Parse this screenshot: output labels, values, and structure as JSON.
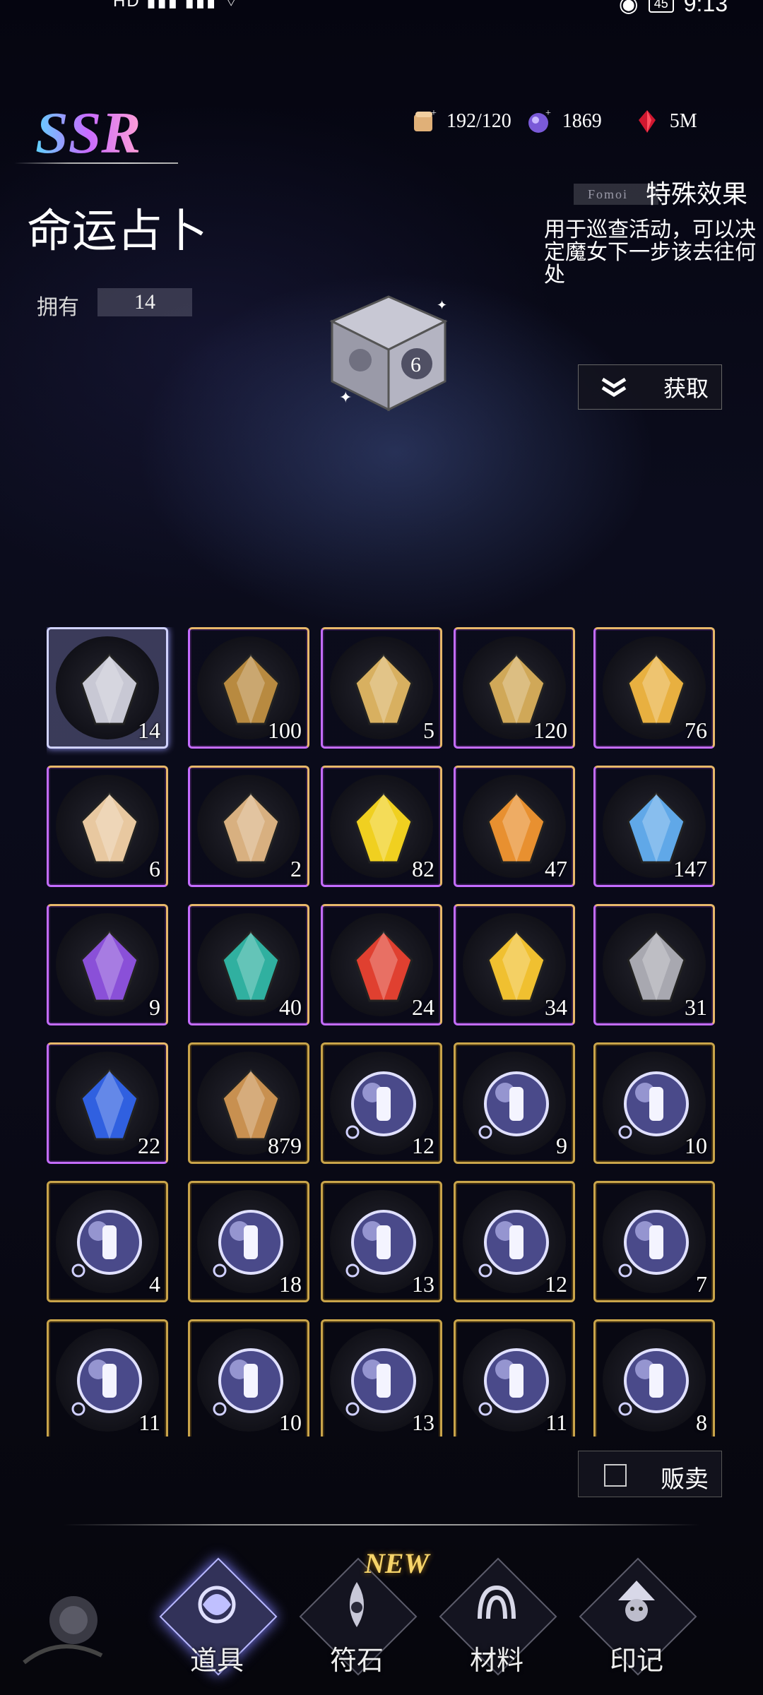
{
  "status_bar": {
    "left": "HD",
    "time": "9:13",
    "battery": "45"
  },
  "item": {
    "rarity": "SSR",
    "name": "命运占卜",
    "owned_label": "拥有",
    "owned_count": "14"
  },
  "currencies": [
    {
      "icon": "scroll-icon",
      "value": "192/120"
    },
    {
      "icon": "crystal-orb-icon",
      "value": "1869"
    },
    {
      "icon": "red-gem-icon",
      "value": "5M"
    }
  ],
  "effect": {
    "tag": "Fomoi",
    "title": "特殊效果",
    "description": "用于巡查活动，可以决定魔女下一步该去往何处"
  },
  "obtain_label": "获取",
  "sell_label": "贩卖",
  "items": [
    {
      "icon": "fate-dice-icon",
      "qty": "14",
      "frame": "selected"
    },
    {
      "icon": "treasure-chest-icon",
      "qty": "100",
      "frame": "purple"
    },
    {
      "icon": "gold-crown-icon",
      "qty": "5",
      "frame": "purple"
    },
    {
      "icon": "gold-helm-icon",
      "qty": "120",
      "frame": "purple"
    },
    {
      "icon": "gold-scroll-icon",
      "qty": "76",
      "frame": "purple"
    },
    {
      "icon": "cupcake-icon",
      "qty": "6",
      "frame": "purple"
    },
    {
      "icon": "cake-icon",
      "qty": "2",
      "frame": "purple"
    },
    {
      "icon": "gold-crystal-icon",
      "qty": "82",
      "frame": "purple"
    },
    {
      "icon": "fire-orb-icon",
      "qty": "47",
      "frame": "purple"
    },
    {
      "icon": "blue-crystal-icon",
      "qty": "147",
      "frame": "purple"
    },
    {
      "icon": "purple-gem-icon",
      "qty": "9",
      "frame": "purple"
    },
    {
      "icon": "teal-ore-icon",
      "qty": "40",
      "frame": "purple"
    },
    {
      "icon": "red-crystal-icon",
      "qty": "24",
      "frame": "purple"
    },
    {
      "icon": "yellow-crystal-icon",
      "qty": "34",
      "frame": "purple"
    },
    {
      "icon": "silver-crystal-icon",
      "qty": "31",
      "frame": "purple"
    },
    {
      "icon": "blue-eye-gem-icon",
      "qty": "22",
      "frame": "purple"
    },
    {
      "icon": "food-basket-icon",
      "qty": "879",
      "frame": "gold"
    },
    {
      "icon": "drum-orb-icon",
      "qty": "12",
      "frame": "gold"
    },
    {
      "icon": "flute-orb-icon",
      "qty": "9",
      "frame": "gold"
    },
    {
      "icon": "guitar-orb-icon",
      "qty": "10",
      "frame": "gold"
    },
    {
      "icon": "organ-orb-icon",
      "qty": "4",
      "frame": "gold"
    },
    {
      "icon": "microphone-orb-icon",
      "qty": "18",
      "frame": "gold"
    },
    {
      "icon": "oboe-orb-icon",
      "qty": "13",
      "frame": "gold"
    },
    {
      "icon": "clarinet-orb-icon",
      "qty": "12",
      "frame": "gold"
    },
    {
      "icon": "horn-orb-icon",
      "qty": "7",
      "frame": "gold"
    },
    {
      "icon": "trombone-orb-icon",
      "qty": "11",
      "frame": "gold"
    },
    {
      "icon": "violin-orb-icon",
      "qty": "10",
      "frame": "gold"
    },
    {
      "icon": "cello-orb-icon",
      "qty": "13",
      "frame": "gold"
    },
    {
      "icon": "piano-orb-icon",
      "qty": "11",
      "frame": "gold"
    },
    {
      "icon": "harp-orb-icon",
      "qty": "8",
      "frame": "gold"
    }
  ],
  "tabs": [
    {
      "label": "道具",
      "icon": "props-tab-icon",
      "active": true
    },
    {
      "label": "符石",
      "icon": "rune-tab-icon",
      "badge": "NEW"
    },
    {
      "label": "材料",
      "icon": "material-tab-icon"
    },
    {
      "label": "印记",
      "icon": "mark-tab-icon"
    }
  ],
  "colors": {
    "gold_frame": "#c9a44a",
    "purple_frame": "#c46cff",
    "selected_frame": "#d0d2ff",
    "new_badge": "#f6d46a"
  }
}
